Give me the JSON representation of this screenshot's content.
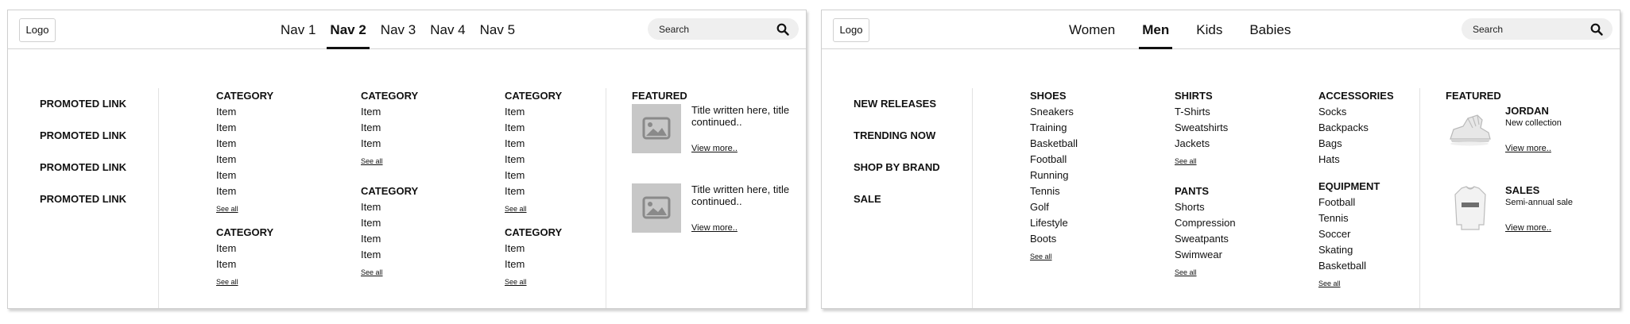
{
  "left_panel": {
    "logo": "Logo",
    "nav": [
      "Nav 1",
      "Nav 2",
      "Nav 3",
      "Nav 4",
      "Nav 5"
    ],
    "active_nav": "Nav 2",
    "search_placeholder": "Search",
    "promoted_links": [
      "PROMOTED LINK",
      "PROMOTED LINK",
      "PROMOTED LINK",
      "PROMOTED LINK"
    ],
    "columns": [
      [
        {
          "title": "CATEGORY",
          "items": [
            "Item",
            "Item",
            "Item",
            "Item",
            "Item",
            "Item"
          ],
          "see_all": "See all"
        },
        {
          "title": "CATEGORY",
          "items": [
            "Item",
            "Item"
          ],
          "see_all": "See all"
        }
      ],
      [
        {
          "title": "CATEGORY",
          "items": [
            "Item",
            "Item",
            "Item"
          ],
          "see_all": "See all"
        },
        {
          "title": "CATEGORY",
          "items": [
            "Item",
            "Item",
            "Item",
            "Item"
          ],
          "see_all": "See all"
        }
      ],
      [
        {
          "title": "CATEGORY",
          "items": [
            "Item",
            "Item",
            "Item",
            "Item",
            "Item",
            "Item"
          ],
          "see_all": "See all"
        },
        {
          "title": "CATEGORY",
          "items": [
            "Item",
            "Item"
          ],
          "see_all": "See all"
        }
      ]
    ],
    "featured": {
      "title": "FEATURED",
      "cards": [
        {
          "text": "Title written here, title continued..",
          "link": "View more.."
        },
        {
          "text": "Title written here, title continued..",
          "link": "View more.."
        }
      ]
    }
  },
  "right_panel": {
    "logo": "Logo",
    "nav": [
      "Women",
      "Men",
      "Kids",
      "Babies"
    ],
    "active_nav": "Men",
    "search_placeholder": "Search",
    "promoted_links": [
      "NEW RELEASES",
      "TRENDING NOW",
      "SHOP BY BRAND",
      "SALE"
    ],
    "columns": [
      [
        {
          "title": "SHOES",
          "items": [
            "Sneakers",
            "Training",
            "Basketball",
            "Football",
            "Running",
            "Tennis",
            "Golf",
            "Lifestyle",
            "Boots"
          ],
          "see_all": "See all"
        }
      ],
      [
        {
          "title": "SHIRTS",
          "items": [
            "T-Shirts",
            "Sweatshirts",
            "Jackets"
          ],
          "see_all": "See all"
        },
        {
          "title": "PANTS",
          "items": [
            "Shorts",
            "Compression",
            "Sweatpants",
            "Swimwear"
          ],
          "see_all": "See all"
        }
      ],
      [
        {
          "title": "ACCESSORIES",
          "items": [
            "Socks",
            "Backpacks",
            "Bags",
            "Hats"
          ],
          "see_all": null
        },
        {
          "title": "EQUIPMENT",
          "items": [
            "Football",
            "Tennis",
            "Soccer",
            "Skating",
            "Basketball"
          ],
          "see_all": "See all"
        }
      ]
    ],
    "featured": {
      "title": "FEATURED",
      "cards": [
        {
          "heading": "JORDAN",
          "sub": "New collection",
          "link": "View more..",
          "icon": "sneaker-image"
        },
        {
          "heading": "SALES",
          "sub": "Semi-annual sale",
          "link": "View more..",
          "icon": "shirt-image"
        }
      ]
    }
  },
  "colors": {
    "text": "#111111",
    "placeholder_image": "#c7c7c7",
    "search_bg": "#efefef",
    "border": "#d4d4d4"
  }
}
